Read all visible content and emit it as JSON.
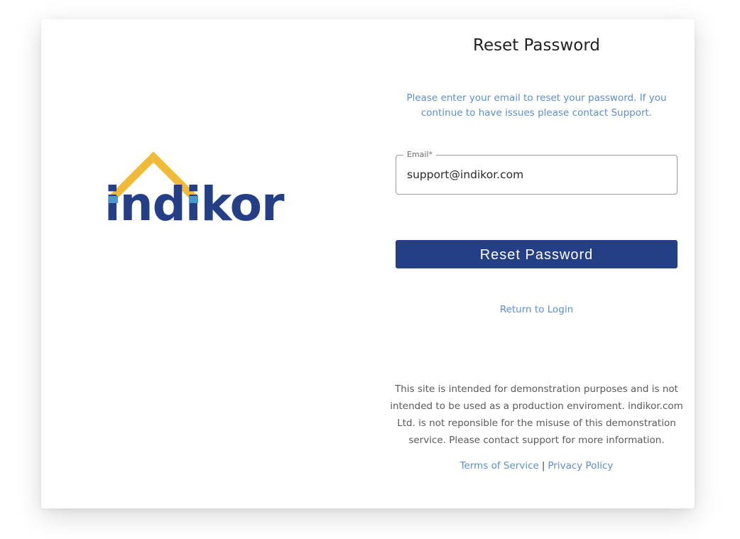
{
  "brand": {
    "name": "indikor",
    "primary_color": "#243f86",
    "roof_color": "#f1bb3a",
    "accent_dot_color": "#4a97d4"
  },
  "page": {
    "title": "Reset Password",
    "intro": "Please enter your email to reset your password. If you continue to have issues please contact Support."
  },
  "form": {
    "email_label": "Email*",
    "email_value": "support@indikor.com",
    "submit_label": "Reset Password"
  },
  "links": {
    "return_to_login": "Return to Login",
    "terms": "Terms of Service",
    "separator": "|",
    "privacy": "Privacy Policy"
  },
  "disclaimer": "This site is intended for demonstration purposes and is not intended to be used as a production enviroment. indikor.com Ltd. is not reponsible for the misuse of this demonstration service. Please contact support for more information.",
  "colors": {
    "link": "#5b8fd0",
    "button_bg": "#243f86",
    "text_muted": "#5a5a5a"
  }
}
